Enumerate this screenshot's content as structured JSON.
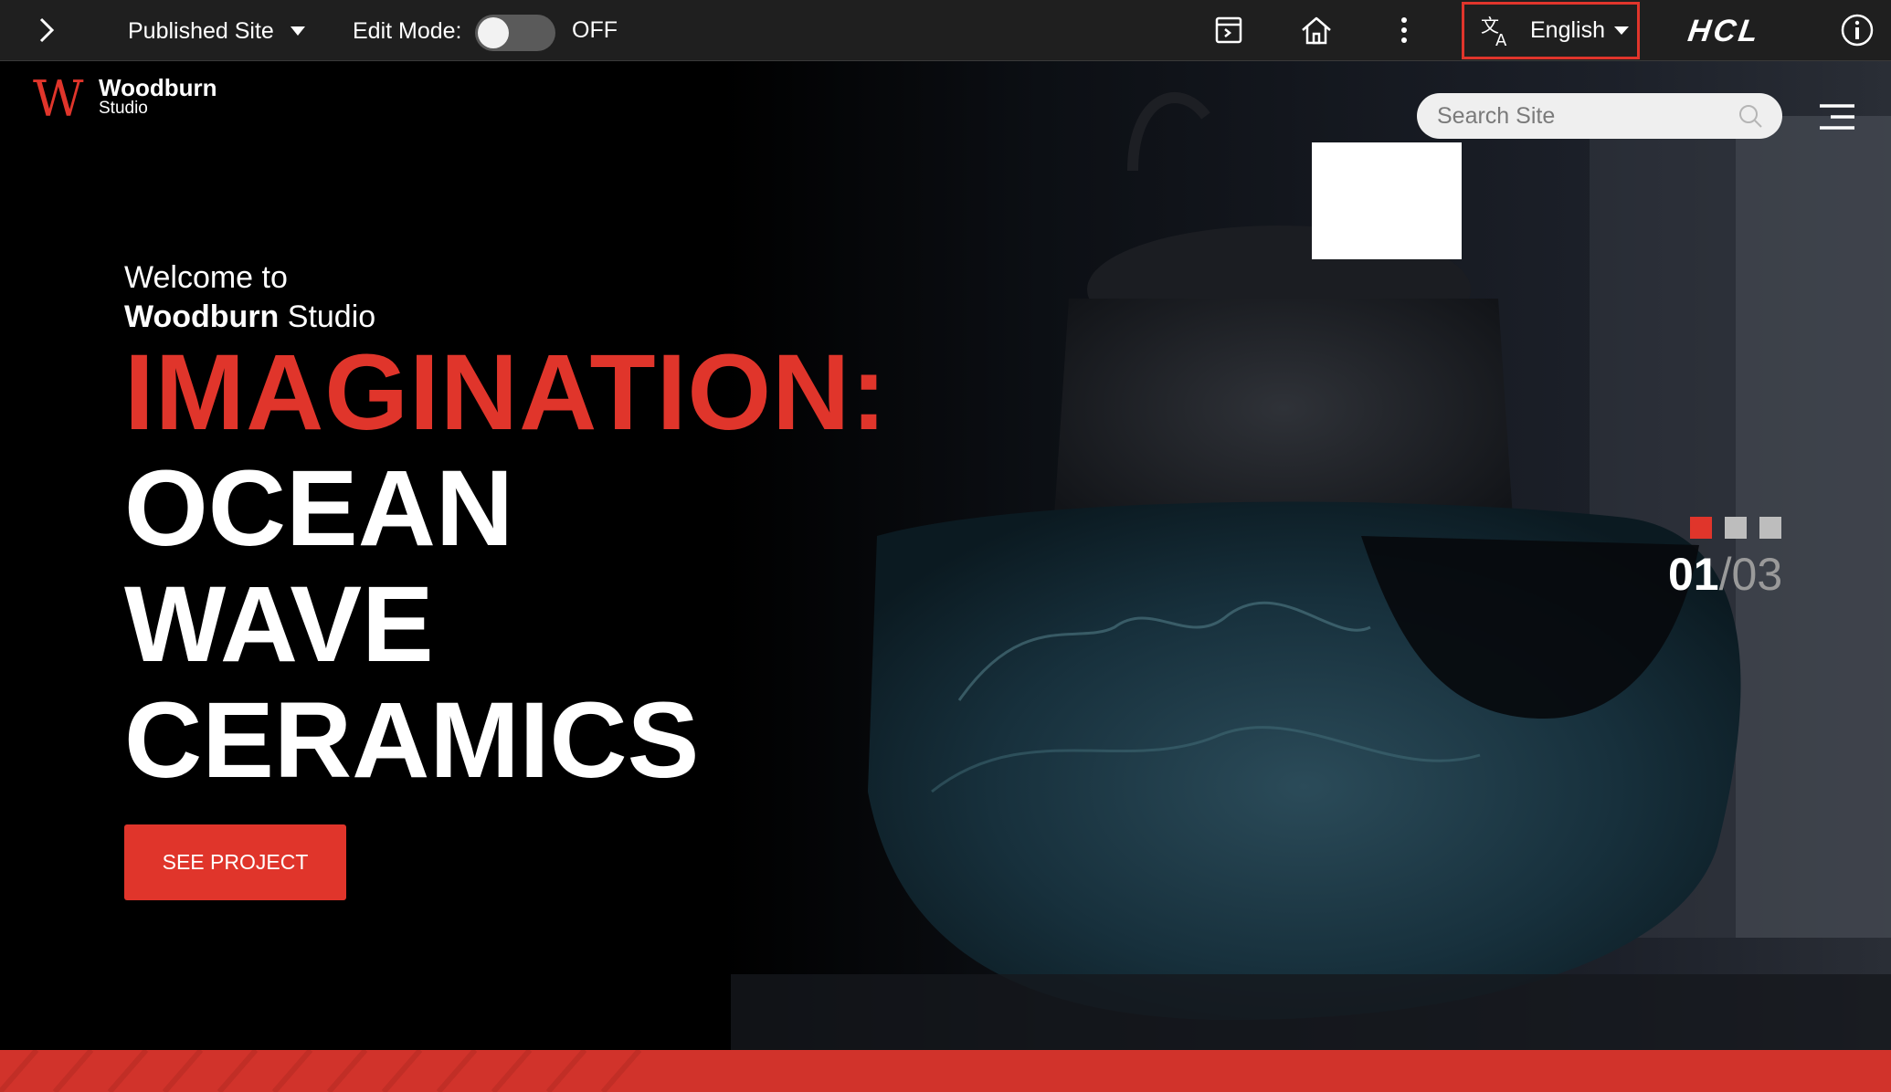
{
  "toolbar": {
    "site_selector": "Published Site",
    "edit_mode_label": "Edit Mode:",
    "edit_mode_state": "OFF",
    "language": "English",
    "brand_logo": "HCL",
    "icons": [
      "chevron-right-icon",
      "preview-panel-icon",
      "home-icon",
      "more-vertical-icon",
      "translate-icon",
      "info-icon"
    ]
  },
  "site": {
    "logo_brand": "Woodburn",
    "logo_sub": "Studio",
    "search_placeholder": "Search Site"
  },
  "hero": {
    "welcome_line1": "Welcome to",
    "welcome_brand": "Woodburn",
    "welcome_sub": " Studio",
    "headline_red": "IMAGINATION:",
    "headline_line1": "OCEAN",
    "headline_line2": "WAVE",
    "headline_line3": "CERAMICS",
    "cta_label": "SEE PROJECT",
    "slide_current": "01",
    "slide_separator": "/",
    "slide_total": "03",
    "active_slide": 1,
    "total_slides": 3
  },
  "colors": {
    "accent_red": "#e0352b",
    "toolbar_bg": "#1f1f1f",
    "inactive_dot": "#bdbdbd"
  }
}
